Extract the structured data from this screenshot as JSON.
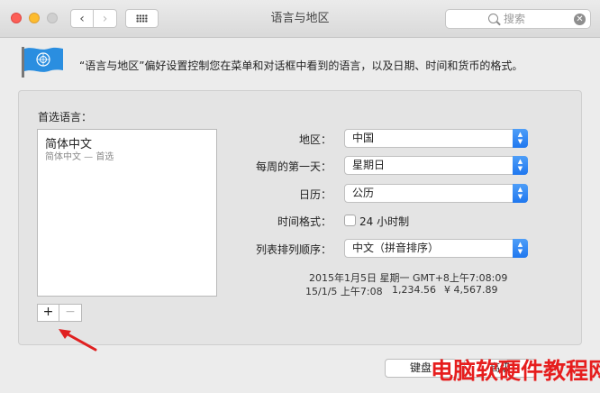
{
  "window": {
    "title": "语言与地区"
  },
  "search": {
    "placeholder": "搜索",
    "clear_glyph": "✕"
  },
  "nav": {
    "back_glyph": "‹",
    "forward_glyph": "›"
  },
  "description": "“语言与地区”偏好设置控制您在菜单和对话框中看到的语言，以及日期、时间和货币的格式。",
  "preferred_languages": {
    "label": "首选语言：",
    "items": [
      {
        "name": "简体中文",
        "subtitle": "简体中文 — 首选"
      }
    ],
    "add_glyph": "+",
    "remove_glyph": "−"
  },
  "settings": {
    "region": {
      "label": "地区：",
      "value": "中国"
    },
    "first_day": {
      "label": "每周的第一天：",
      "value": "星期日"
    },
    "calendar": {
      "label": "日历：",
      "value": "公历"
    },
    "time_format": {
      "label": "时间格式：",
      "checkbox_label": "24 小时制",
      "checked": false
    },
    "sort_order": {
      "label": "列表排列顺序：",
      "value": "中文（拼音排序）"
    }
  },
  "sample": {
    "line1": "2015年1月5日 星期一 GMT+8上午7:08:09",
    "short_date": "15/1/5 上午7:08",
    "number": "1,234.56",
    "currency": "¥ 4,567.89"
  },
  "buttons": {
    "keyboard": "键盘",
    "advanced": "高级"
  },
  "watermark": "电脑软硬件教程网",
  "colors": {
    "accent": "#1f77ef",
    "arrow": "#e02020",
    "watermark": "#e61e1e"
  }
}
